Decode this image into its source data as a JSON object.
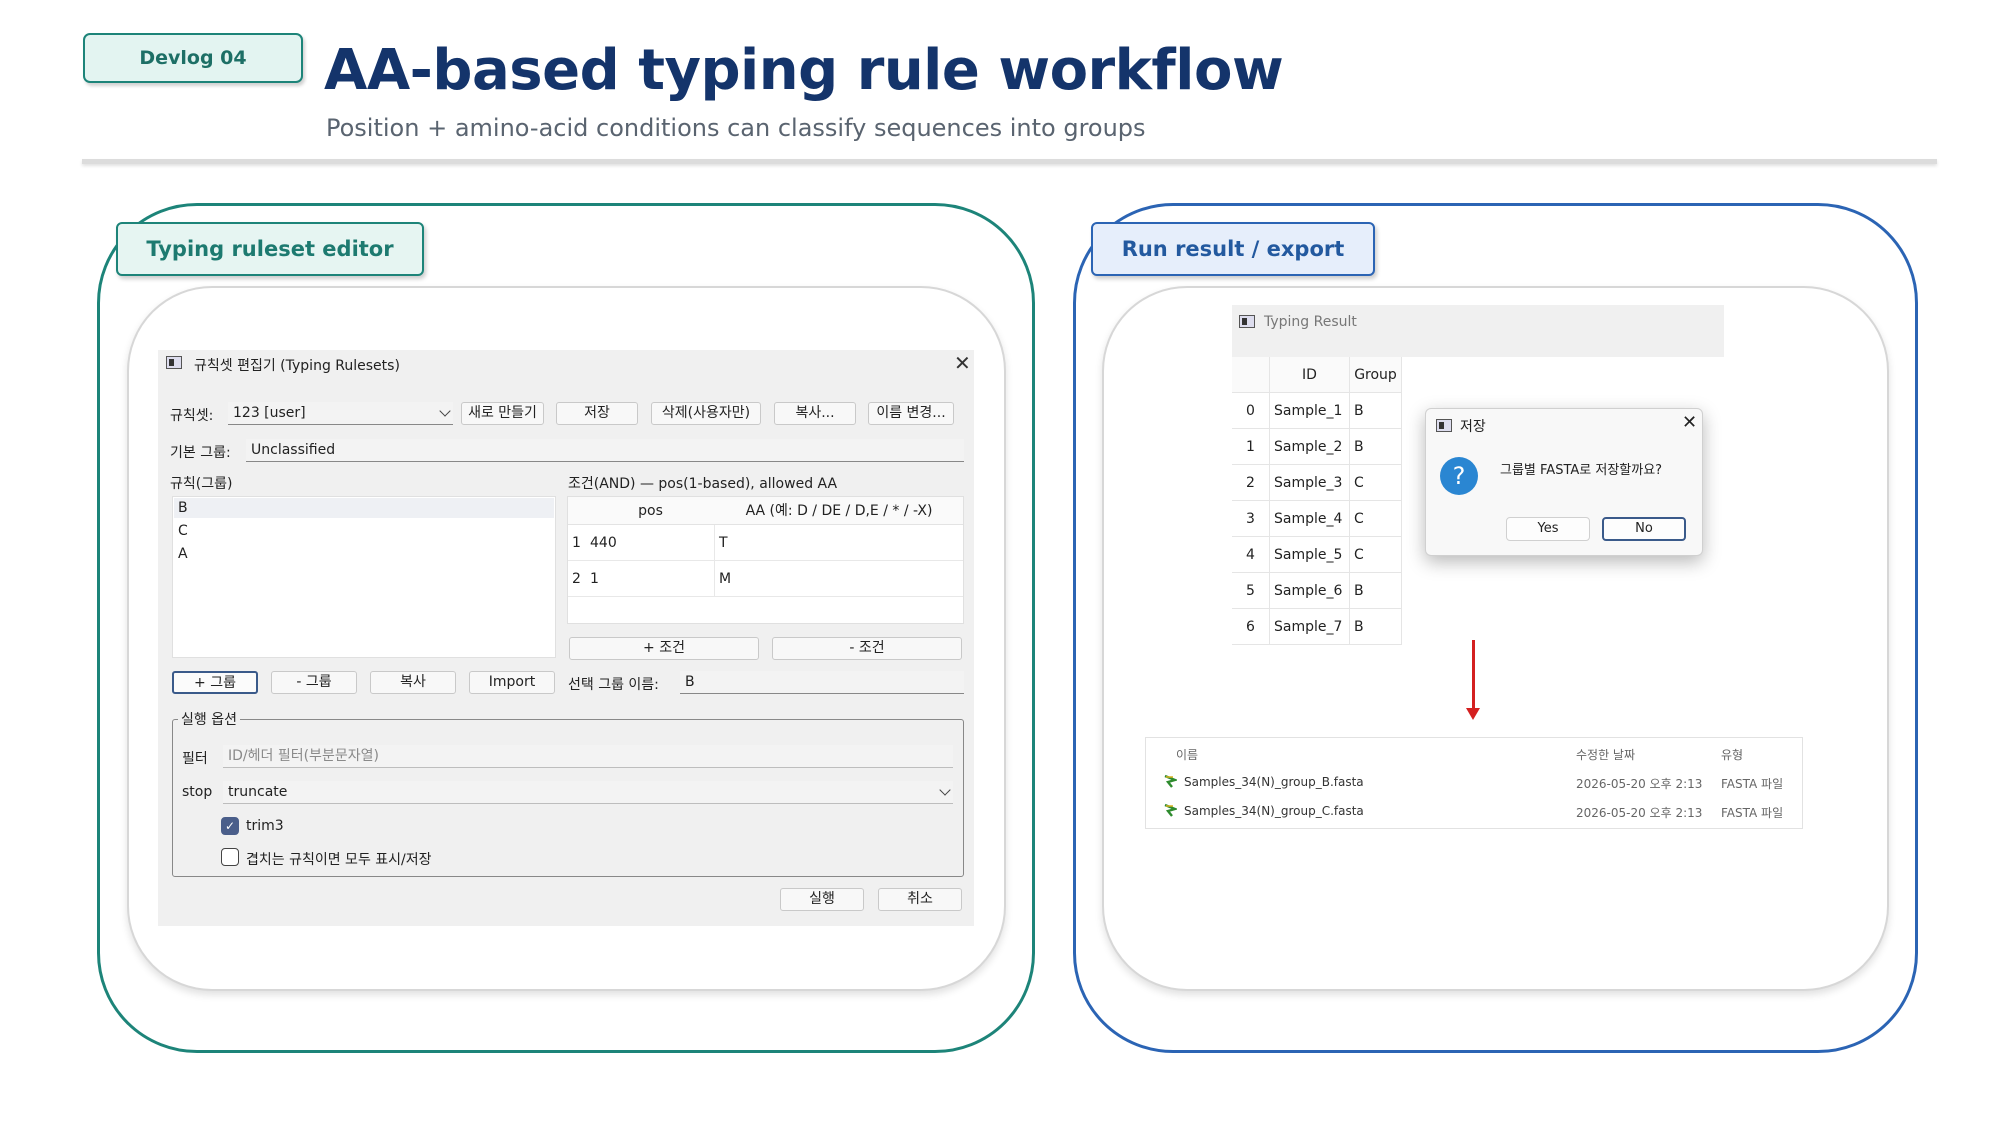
{
  "header": {
    "badge": "Devlog 04",
    "title": "AA-based typing rule workflow",
    "subtitle": "Position + amino-acid conditions can classify sequences into groups"
  },
  "panels": {
    "left_tag": "Typing ruleset editor",
    "right_tag": "Run result / export"
  },
  "editor": {
    "window_title": "규칙셋 편집기 (Typing Rulesets)",
    "ruleset_label": "규칙셋:",
    "ruleset_value": "123 [user]",
    "buttons": {
      "new": "새로 만들기",
      "save": "저장",
      "delete": "삭제(사용자만)",
      "copy": "복사...",
      "rename": "이름 변경..."
    },
    "default_group_label": "기본 그룹:",
    "default_group_value": "Unclassified",
    "rules_label": "규칙(그룹)",
    "groups": [
      "B",
      "C",
      "A"
    ],
    "conditions_label": "조건(AND)  —  pos(1-based), allowed AA",
    "condition_columns": [
      "pos",
      "AA (예: D / DE / D,E / * / -X)"
    ],
    "conditions": [
      {
        "row": "1",
        "pos": "440",
        "aa": "T"
      },
      {
        "row": "2",
        "pos": "1",
        "aa": "M"
      }
    ],
    "add_condition": "+ 조건",
    "remove_condition": "- 조건",
    "add_group": "+ 그룹",
    "remove_group": "- 그룹",
    "copy_group": "복사",
    "import": "Import",
    "selected_group_label": "선택 그룹 이름:",
    "selected_group_value": "B",
    "run_options_label": "실행 옵션",
    "filter_label": "필터",
    "filter_placeholder": "ID/헤더 필터(부분문자열)",
    "stop_label": "stop",
    "stop_value": "truncate",
    "trim3_label": "trim3",
    "trim3_checked": true,
    "overlap_label": "겹치는 규칙이면 모두 표시/저장",
    "overlap_checked": false,
    "run": "실행",
    "cancel": "취소"
  },
  "result": {
    "window_title": "Typing Result",
    "columns": [
      "ID",
      "Group"
    ],
    "rows": [
      {
        "idx": "0",
        "id": "Sample_1",
        "group": "B"
      },
      {
        "idx": "1",
        "id": "Sample_2",
        "group": "B"
      },
      {
        "idx": "2",
        "id": "Sample_3",
        "group": "C"
      },
      {
        "idx": "3",
        "id": "Sample_4",
        "group": "C"
      },
      {
        "idx": "4",
        "id": "Sample_5",
        "group": "C"
      },
      {
        "idx": "5",
        "id": "Sample_6",
        "group": "B"
      },
      {
        "idx": "6",
        "id": "Sample_7",
        "group": "B"
      }
    ],
    "dialog": {
      "title": "저장",
      "message": "그룹별 FASTA로 저장할까요?",
      "yes": "Yes",
      "no": "No"
    }
  },
  "explorer": {
    "columns": [
      "이름",
      "수정한 날짜",
      "유형"
    ],
    "files": [
      {
        "name": "Samples_34(N)_group_B.fasta",
        "date": "2026-05-20 오후 2:13",
        "type": "FASTA 파일"
      },
      {
        "name": "Samples_34(N)_group_C.fasta",
        "date": "2026-05-20 오후 2:13",
        "type": "FASTA 파일"
      }
    ]
  },
  "colors": {
    "teal": "#1d8479",
    "blue": "#2b64b4",
    "title_navy": "#14346b",
    "arrow_red": "#d42020"
  }
}
